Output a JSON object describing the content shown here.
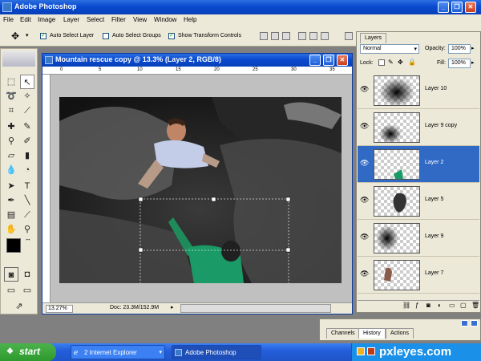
{
  "app": {
    "title": "Adobe Photoshop"
  },
  "menu": [
    "File",
    "Edit",
    "Image",
    "Layer",
    "Select",
    "Filter",
    "View",
    "Window",
    "Help"
  ],
  "options": {
    "auto_select_layer": "Auto Select Layer",
    "auto_select_groups": "Auto Select Groups",
    "show_transform_controls": "Show Transform Controls"
  },
  "document": {
    "title": "Mountain rescue copy @ 13.3% (Layer 2, RGB/8)",
    "ruler_ticks": [
      "0",
      "5",
      "10",
      "15",
      "20",
      "25",
      "30",
      "35"
    ],
    "zoom": "13.27%",
    "doc_info": "Doc: 23.3M/152.9M"
  },
  "layers_panel": {
    "tab": "Layers",
    "blend_mode": "Normal",
    "opacity_label": "Opacity:",
    "opacity": "100%",
    "lock_label": "Lock:",
    "fill_label": "Fill:",
    "fill": "100%",
    "layers": [
      {
        "name": "Layer 10",
        "selected": false
      },
      {
        "name": "Layer 9 copy",
        "selected": false
      },
      {
        "name": "Layer 2",
        "selected": true
      },
      {
        "name": "Layer 5",
        "selected": false
      },
      {
        "name": "Layer 9",
        "selected": false
      },
      {
        "name": "Layer 7",
        "selected": false
      }
    ]
  },
  "history_panel": {
    "tabs": [
      "Channels",
      "History",
      "Actions"
    ]
  },
  "taskbar": {
    "start": "start",
    "tasks": [
      "2 Internet Explorer",
      "Adobe Photoshop"
    ],
    "brand": "pxleyes.com"
  }
}
